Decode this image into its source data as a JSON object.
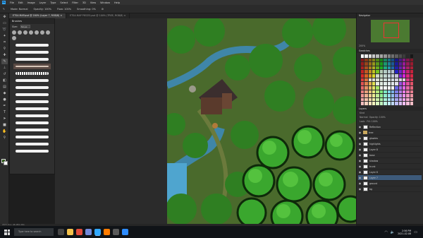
{
  "app": {
    "logo": "Ps",
    "menus": [
      "File",
      "Edit",
      "Image",
      "Layer",
      "Type",
      "Select",
      "Filter",
      "3D",
      "View",
      "Window",
      "Help"
    ]
  },
  "options": {
    "mode_label": "Mode:",
    "mode_value": "Normal",
    "opacity_label": "Opacity:",
    "opacity_value": "100%",
    "flow_label": "Flow:",
    "flow_value": "100%",
    "smoothing_label": "Smoothing:",
    "smoothing_value": "0%"
  },
  "tabs": [
    {
      "label": "ETSA MAP.psd @ 200% (Layer 7, RGB/8) ×",
      "active": true
    },
    {
      "label": "ETSA MAP PIECES.psd @ 100% (TREE, RGB/8) ×",
      "active": false
    }
  ],
  "brushes_panel": {
    "title": "Brushes",
    "size_label": "Size:",
    "size_value": "50 px"
  },
  "navigator": {
    "title": "Navigator",
    "zoom": "200%"
  },
  "swatches": {
    "title": "Swatches"
  },
  "layers": {
    "title": "Layers",
    "kind_label": "Kind",
    "blend": "Normal",
    "opacity_label": "Opacity: 100%",
    "lock_label": "Lock:",
    "fill_label": "Fill: 100%",
    "rows": [
      {
        "name": "Reflection",
        "type": "layer",
        "active": false
      },
      {
        "name": "tree",
        "type": "folder",
        "active": false
      },
      {
        "name": "glowies",
        "type": "layer",
        "active": false
      },
      {
        "name": "highlights",
        "type": "layer",
        "active": false
      },
      {
        "name": "Layer 8",
        "type": "layer",
        "active": false
      },
      {
        "name": "base",
        "type": "layer",
        "active": false
      },
      {
        "name": "shadow",
        "type": "layer",
        "active": false
      },
      {
        "name": "trunk",
        "type": "layer",
        "active": false
      },
      {
        "name": "Layer 6",
        "type": "layer",
        "active": false
      },
      {
        "name": "Layer 7",
        "type": "layer",
        "active": true
      },
      {
        "name": "ground",
        "type": "layer",
        "active": false
      },
      {
        "name": "bg",
        "type": "layer",
        "active": false
      }
    ]
  },
  "statusbar": {
    "text": "200%   Doc: 48.4M/1.46G"
  },
  "taskbar": {
    "search_placeholder": "Type here to search",
    "time": "2:56 PM",
    "date": "2021-02-08"
  },
  "colors": {
    "foreground": "#2e5a17",
    "background": "#ffffff",
    "ps_blue": "#31a8ff"
  }
}
